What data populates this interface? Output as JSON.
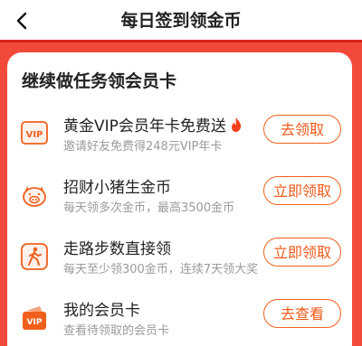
{
  "header": {
    "title": "每日签到领金币"
  },
  "card": {
    "title": "继续做任务领会员卡",
    "tasks": [
      {
        "name": "黄金VIP会员年卡免费送",
        "desc": "邀请好友免费得248元VIP年卡",
        "button": "去领取",
        "icon": "vip-card-icon",
        "has_fire": true
      },
      {
        "name": "招财小猪生金币",
        "desc": "每天领多次金币，最高3500金币",
        "button": "立即领取",
        "icon": "pig-icon"
      },
      {
        "name": "走路步数直接领",
        "desc": "每天至少领300金币，连续7天领大奖",
        "button": "立即领取",
        "icon": "walking-icon"
      },
      {
        "name": "我的会员卡",
        "desc": "查看待领取的会员卡",
        "button": "去查看",
        "icon": "vip-wallet-icon"
      }
    ]
  },
  "colors": {
    "accent": "#f05a1a",
    "brand_red": "#f24a3a",
    "border_red": "#d9221e"
  }
}
